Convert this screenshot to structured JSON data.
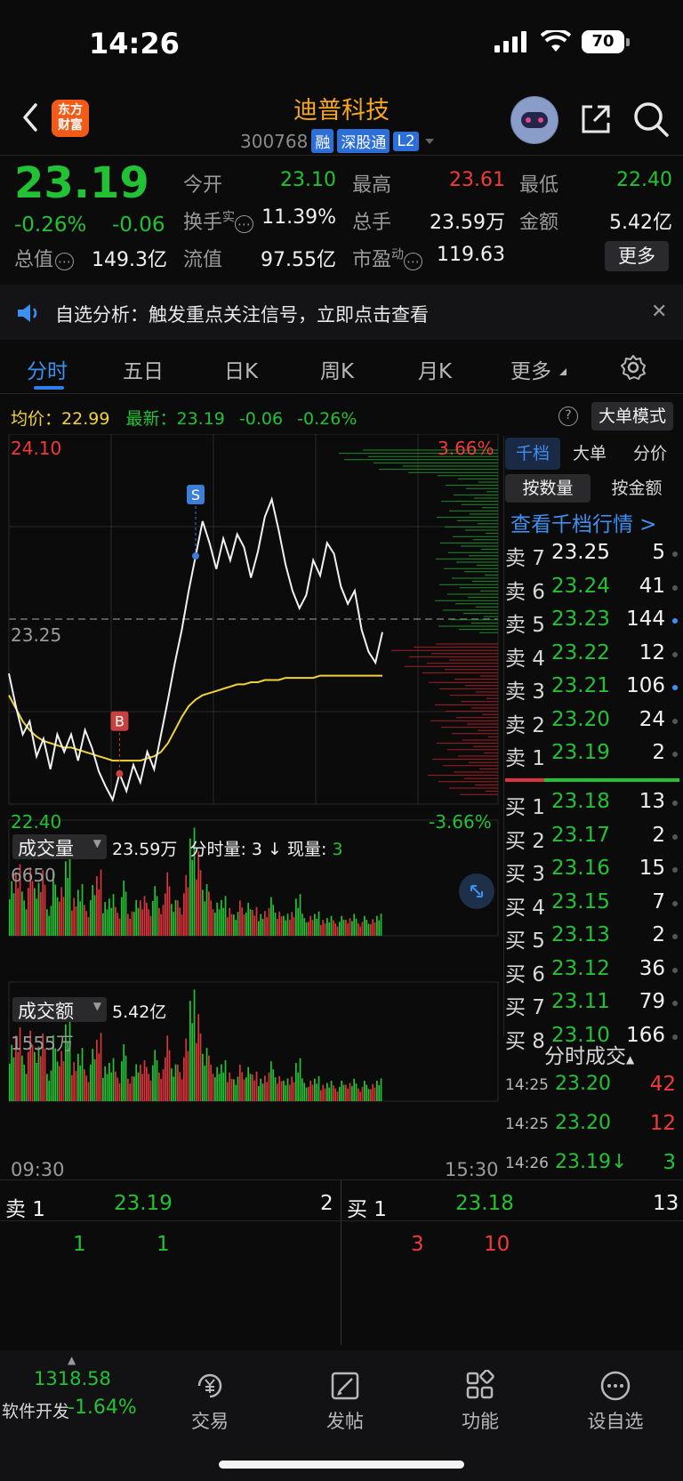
{
  "status_bar": {
    "time": "14:26",
    "battery": "70"
  },
  "header": {
    "stock_name": "迪普科技",
    "stock_code": "300768",
    "tags": [
      "融",
      "深股通",
      "L2"
    ],
    "logo_text": "东方财富"
  },
  "quote": {
    "last_price": "23.19",
    "change_pct": "-0.26%",
    "change_amt": "-0.06",
    "open_label": "今开",
    "open": "23.10",
    "high_label": "最高",
    "high": "23.61",
    "low_label": "最低",
    "low": "22.40",
    "turnover_label": "换手",
    "turnover_sup": "实",
    "turnover": "11.39%",
    "volume_label": "总手",
    "volume": "23.59万",
    "amount_label": "金额",
    "amount": "5.42亿",
    "mktcap_label": "总值",
    "mktcap": "149.3亿",
    "float_label": "流值",
    "float": "97.55亿",
    "pe_label": "市盈",
    "pe_sup": "动",
    "pe": "119.63",
    "more_label": "更多"
  },
  "notice": {
    "text": "自选分析：触发重点关注信号，立即点击查看"
  },
  "tabs": [
    "分时",
    "五日",
    "日K",
    "周K",
    "月K",
    "更多"
  ],
  "price_info": {
    "avg_label": "均价：",
    "avg": "22.99",
    "latest_label": "最新：",
    "latest": "23.19",
    "latest_chg": "-0.06",
    "latest_pct": "-0.26%",
    "big_order_label": "大单模式"
  },
  "chart_data": {
    "type": "line",
    "y_top_label": "24.10",
    "y_mid_label": "23.25",
    "y_bottom_label": "22.40",
    "pct_top_label": "3.66%",
    "pct_bottom_label": "-3.66%",
    "ylim": [
      22.4,
      24.1
    ],
    "x_start_label": "09:30",
    "x_end_label": "15:30",
    "markers": [
      {
        "label": "S",
        "price": 23.54
      },
      {
        "label": "B",
        "price": 22.52
      }
    ],
    "price_series": [
      23.0,
      22.85,
      22.72,
      22.78,
      22.62,
      22.7,
      22.56,
      22.72,
      22.64,
      22.72,
      22.6,
      22.74,
      22.66,
      22.55,
      22.48,
      22.42,
      22.54,
      22.46,
      22.58,
      22.5,
      22.64,
      22.56,
      22.72,
      22.88,
      23.05,
      23.2,
      23.38,
      23.54,
      23.7,
      23.6,
      23.48,
      23.62,
      23.52,
      23.64,
      23.58,
      23.44,
      23.56,
      23.72,
      23.8,
      23.66,
      23.5,
      23.38,
      23.3,
      23.36,
      23.52,
      23.45,
      23.6,
      23.55,
      23.4,
      23.32,
      23.38,
      23.2,
      23.1,
      23.05,
      23.19
    ],
    "avg_series": [
      22.9,
      22.84,
      22.78,
      22.74,
      22.71,
      22.69,
      22.68,
      22.67,
      22.66,
      22.66,
      22.65,
      22.64,
      22.63,
      22.62,
      22.61,
      22.6,
      22.6,
      22.6,
      22.6,
      22.6,
      22.61,
      22.62,
      22.64,
      22.68,
      22.74,
      22.8,
      22.85,
      22.88,
      22.9,
      22.91,
      22.92,
      22.93,
      22.94,
      22.95,
      22.95,
      22.96,
      22.96,
      22.97,
      22.97,
      22.97,
      22.98,
      22.98,
      22.98,
      22.98,
      22.98,
      22.99,
      22.99,
      22.99,
      22.99,
      22.99,
      22.99,
      22.99,
      22.99,
      22.99,
      22.99
    ],
    "volume_label": "成交量",
    "volume_total": "23.59万",
    "tick_vol_label": "分时量: 3 ↓ 现量:",
    "tick_vol_now": "3",
    "volume_axis_max": "6650",
    "amount_label": "成交额",
    "amount_total": "5.42亿",
    "amount_axis_max": "1555万",
    "volume_bars": [
      0.55,
      0.72,
      0.4,
      0.62,
      0.48,
      0.66,
      0.3,
      0.58,
      0.44,
      0.75,
      0.38,
      0.52,
      0.28,
      0.46,
      0.6,
      0.34,
      0.42,
      0.26,
      0.5,
      0.22,
      0.36,
      0.4,
      0.3,
      0.45,
      0.28,
      0.64,
      0.36,
      0.32,
      0.55,
      0.98,
      0.85,
      0.52,
      0.4,
      0.3,
      0.36,
      0.28,
      0.24,
      0.32,
      0.3,
      0.26,
      0.22,
      0.28,
      0.35,
      0.22,
      0.2,
      0.24,
      0.42,
      0.2,
      0.18,
      0.22,
      0.16,
      0.2,
      0.14,
      0.18,
      0.16,
      0.22,
      0.14,
      0.18,
      0.15,
      0.2
    ],
    "bar_colors": [
      "g",
      "r",
      "g",
      "r",
      "g",
      "r",
      "g",
      "g",
      "r",
      "g",
      "r",
      "g",
      "r",
      "g",
      "r",
      "g",
      "g",
      "r",
      "g",
      "r",
      "g",
      "r",
      "r",
      "g",
      "r",
      "r",
      "g",
      "r",
      "r",
      "g",
      "r",
      "g",
      "r",
      "g",
      "g",
      "r",
      "g",
      "r",
      "g",
      "r",
      "g",
      "r",
      "g",
      "r",
      "g",
      "r",
      "g",
      "g",
      "r",
      "g",
      "r",
      "g",
      "r",
      "g",
      "r",
      "g",
      "r",
      "g",
      "r",
      "g"
    ]
  },
  "order_book": {
    "tab_1000": "千档",
    "tab_big": "大单",
    "tab_price": "分价",
    "seg_qty": "按数量",
    "seg_amt": "按金额",
    "view_link": "查看千档行情 >",
    "asks": [
      {
        "label": "卖 7",
        "price": "23.25",
        "vol": "5",
        "dot": "gray"
      },
      {
        "label": "卖 6",
        "price": "23.24",
        "vol": "41",
        "dot": "gray"
      },
      {
        "label": "卖 5",
        "price": "23.23",
        "vol": "144",
        "dot": "blue"
      },
      {
        "label": "卖 4",
        "price": "23.22",
        "vol": "12",
        "dot": "gray"
      },
      {
        "label": "卖 3",
        "price": "23.21",
        "vol": "106",
        "dot": "blue"
      },
      {
        "label": "卖 2",
        "price": "23.20",
        "vol": "24",
        "dot": "gray"
      },
      {
        "label": "卖 1",
        "price": "23.19",
        "vol": "2",
        "dot": "gray"
      }
    ],
    "bids": [
      {
        "label": "买 1",
        "price": "23.18",
        "vol": "13",
        "dot": "gray"
      },
      {
        "label": "买 2",
        "price": "23.17",
        "vol": "2",
        "dot": "gray"
      },
      {
        "label": "买 3",
        "price": "23.16",
        "vol": "15",
        "dot": "gray"
      },
      {
        "label": "买 4",
        "price": "23.15",
        "vol": "7",
        "dot": "gray"
      },
      {
        "label": "买 5",
        "price": "23.13",
        "vol": "2",
        "dot": "gray"
      },
      {
        "label": "买 6",
        "price": "23.12",
        "vol": "36",
        "dot": "gray"
      },
      {
        "label": "买 7",
        "price": "23.11",
        "vol": "79",
        "dot": "gray"
      },
      {
        "label": "买 8",
        "price": "23.10",
        "vol": "166",
        "dot": "gray"
      }
    ],
    "ticks_title": "分时成交",
    "ticks": [
      {
        "time": "14:25",
        "price": "23.20",
        "vol": "42",
        "color": "red"
      },
      {
        "time": "14:25",
        "price": "23.20",
        "vol": "12",
        "color": "red"
      },
      {
        "time": "14:26",
        "price": "23.19↓",
        "vol": "3",
        "color": "green"
      }
    ]
  },
  "bottom_trade": {
    "sell_label": "卖 1",
    "sell_price": "23.19",
    "sell_vol": "2",
    "buy_label": "买 1",
    "buy_price": "23.18",
    "buy_vol": "13",
    "sell_sub": [
      "1",
      "1"
    ],
    "buy_sub": [
      "3",
      "10"
    ]
  },
  "bottom_nav": {
    "index_value": "1318.58",
    "index_name": "软件开发",
    "index_pct": "-1.64%",
    "items": [
      "交易",
      "发帖",
      "功能",
      "设自选"
    ]
  }
}
